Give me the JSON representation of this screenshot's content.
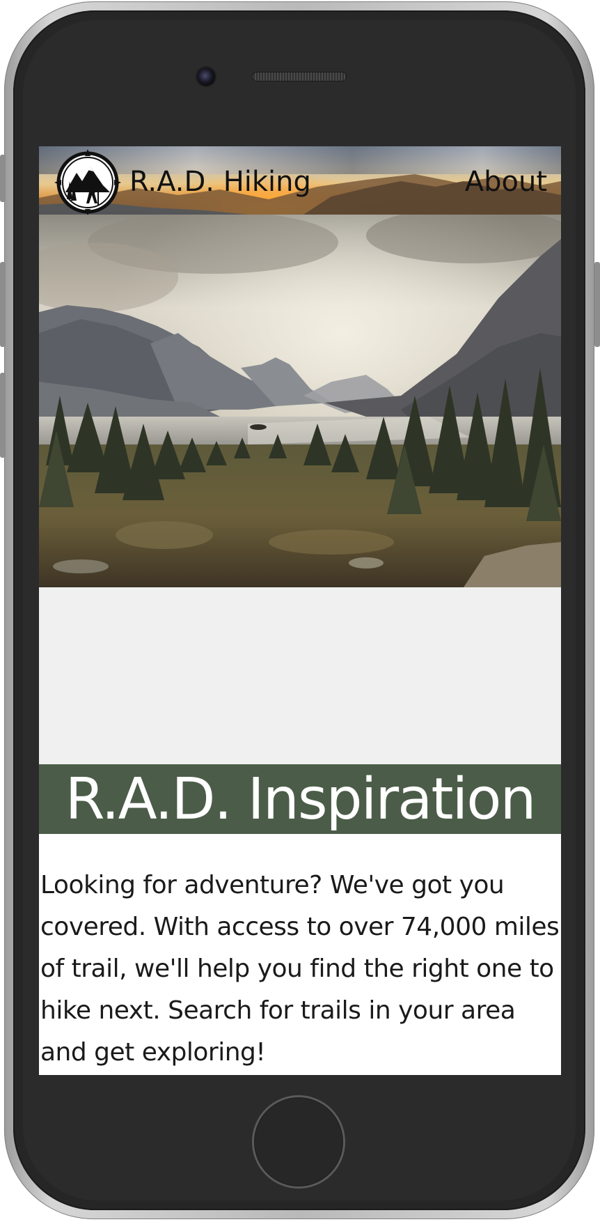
{
  "site": {
    "brand_title": "R.A.D. Hiking",
    "nav": {
      "about_label": "About"
    }
  },
  "hero": {
    "image_description": "mountain lake valley with pine forest"
  },
  "inspiration": {
    "heading": "R.A.D. Inspiration",
    "body": "Looking for adventure? We've got you covered. With access to over 74,000 miles of trail, we'll help you find the right one to hike next. Search for trails in your area and get exploring!"
  },
  "colors": {
    "title_band": "#4b5d48",
    "phone_body": "#262626",
    "screen_background": "#f0f0f0"
  },
  "icons": {
    "logo": "hiker-compass-logo-icon"
  }
}
